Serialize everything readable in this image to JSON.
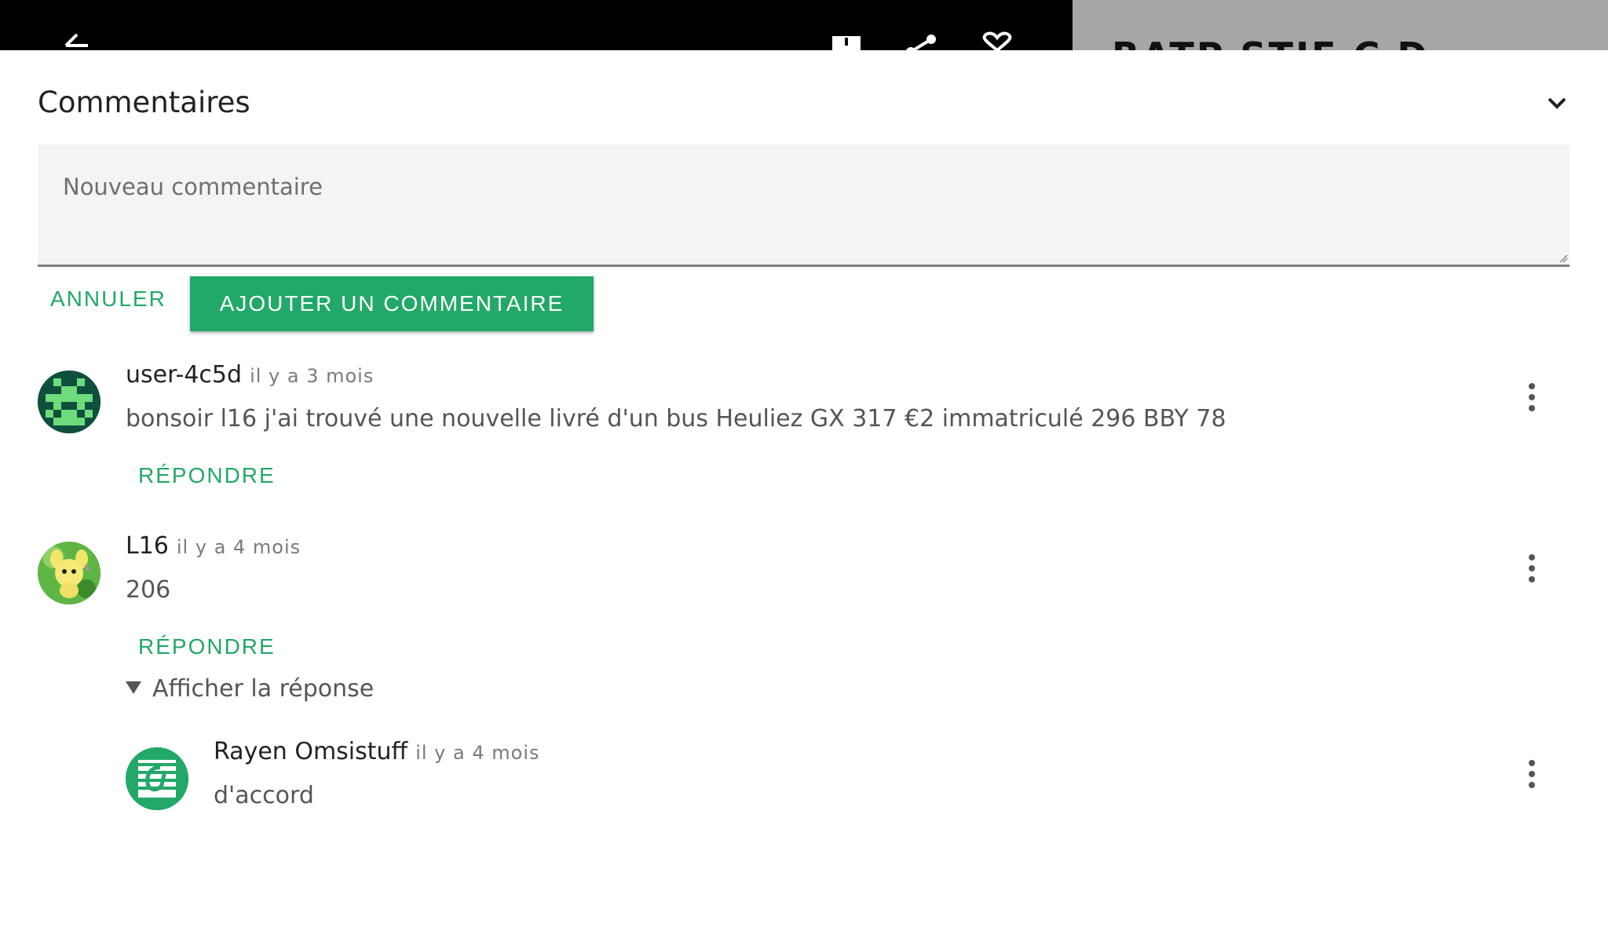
{
  "colors": {
    "accent": "#22a868",
    "top_bar": "#000000",
    "side_panel": "#a6a6a6"
  },
  "topbar": {
    "icons": [
      "back-arrow-icon",
      "download-icon",
      "share-icon",
      "heart-icon"
    ],
    "peek_text": "RATP STIF C D"
  },
  "comments_section": {
    "title": "Commentaires",
    "collapse_icon": "chevron-down-icon",
    "new_comment": {
      "placeholder": "Nouveau commentaire",
      "value": ""
    },
    "cancel_label": "ANNULER",
    "add_label": "AJOUTER UN COMMENTAIRE",
    "comments": [
      {
        "author": "user-4c5d",
        "time": "il y a 3 mois",
        "text": "bonsoir l16 j'ai trouvé une nouvelle livré d'un bus Heuliez GX 317 €2 immatriculé 296 BBY 78",
        "reply_label": "RÉPONDRE",
        "avatar": "pixel-avatar"
      },
      {
        "author": "L16",
        "time": "il y a 4 mois",
        "text": "206",
        "reply_label": "RÉPONDRE",
        "show_replies_label": "Afficher la réponse",
        "avatar": "creature-avatar",
        "replies": [
          {
            "author": "Rayen Omsistuff",
            "time": "il y a 4 mois",
            "text": "d'accord",
            "avatar": "logo-avatar"
          }
        ]
      }
    ]
  }
}
